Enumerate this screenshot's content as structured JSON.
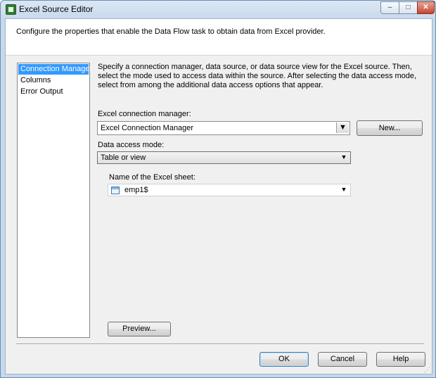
{
  "window": {
    "title": "Excel Source Editor",
    "controls": {
      "minimize": "–",
      "maximize": "□",
      "close": "✕"
    }
  },
  "header": {
    "description": "Configure the properties that enable the Data Flow task to obtain data from Excel provider."
  },
  "nav": {
    "items": [
      "Connection Manager",
      "Columns",
      "Error Output"
    ],
    "selected": "Connection Manager"
  },
  "main": {
    "instructions": "Specify a connection manager, data source, or data source view for the Excel source. Then, select the mode used to access data within the source. After selecting the data access mode, select from among the additional data access options that appear.",
    "connection_manager_label": "Excel connection manager:",
    "connection_manager_value": "Excel Connection Manager",
    "new_button": "New...",
    "access_mode_label": "Data access mode:",
    "access_mode_value": "Table or view",
    "sheet_label": "Name of the Excel sheet:",
    "sheet_value": "emp1$",
    "preview_button": "Preview..."
  },
  "footer": {
    "ok": "OK",
    "cancel": "Cancel",
    "help": "Help"
  },
  "icons": {
    "app": "excel-source-icon",
    "sheet": "table-icon",
    "dropdown": "chevron-down-icon"
  }
}
